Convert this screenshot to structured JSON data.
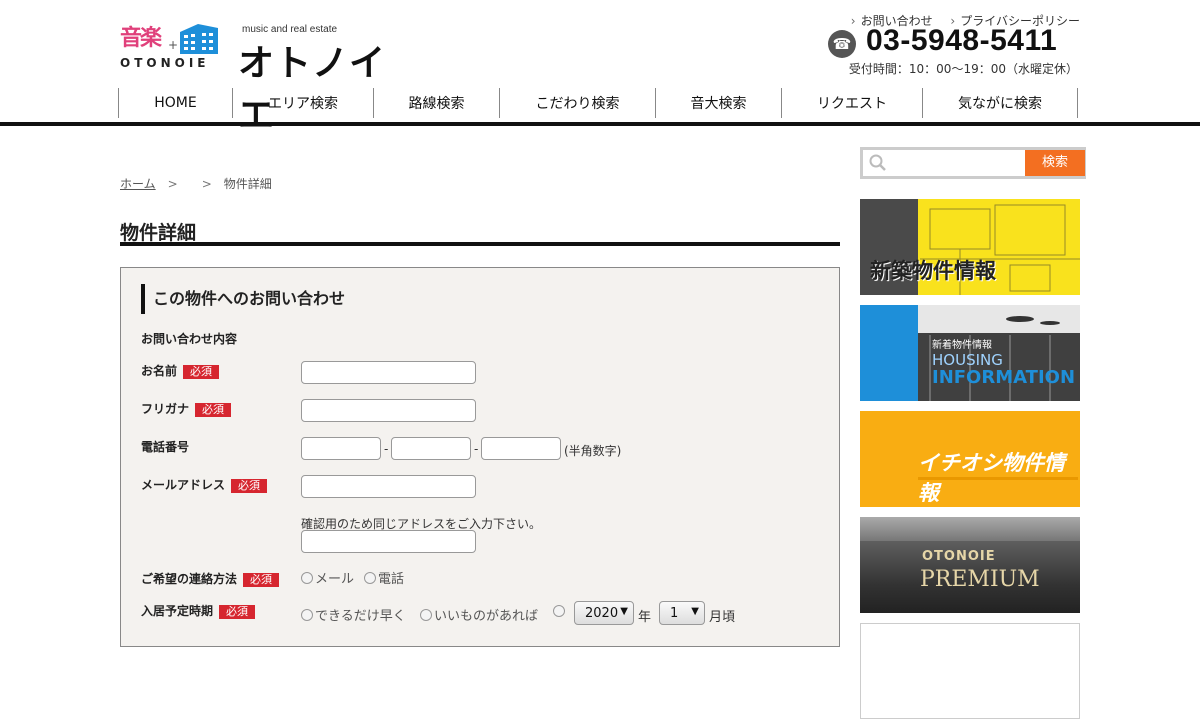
{
  "header": {
    "logo_kanji": "音楽",
    "logo_roman": "OTONOIE",
    "logo_tagline": "music and real estate",
    "logo_name": "オトノイエ",
    "top_links": [
      "お問い合わせ",
      "プライバシーポリシー"
    ],
    "phone": "03-5948-5411",
    "hours": "受付時間：10：00～19：00（水曜定休）"
  },
  "nav": [
    {
      "label": "HOME"
    },
    {
      "label": "エリア検索"
    },
    {
      "label": "路線検索"
    },
    {
      "label": "こだわり検索"
    },
    {
      "label": "音大検索"
    },
    {
      "label": "リクエスト"
    },
    {
      "label": "気ながに検索"
    }
  ],
  "breadcrumb": {
    "home": "ホーム",
    "sep1": ">",
    "sep2": ">",
    "current": "物件詳細"
  },
  "page_title": "物件詳細",
  "form": {
    "heading": "この物件へのお問い合わせ",
    "subheading": "お問い合わせ内容",
    "required_badge": "必須",
    "fields": {
      "name": "お名前",
      "furigana": "フリガナ",
      "phone": "電話番号",
      "phone_note": "(半角数字)",
      "phone_dash": "-",
      "email": "メールアドレス",
      "email_confirm_note": "確認用のため同じアドレスをご入力下さい。",
      "contact_method": "ご希望の連絡方法",
      "contact_options": [
        "メール",
        "電話"
      ],
      "move_in": "入居予定時期",
      "move_in_options": [
        "できるだけ早く",
        "いいものがあれば"
      ],
      "year_value": "2020",
      "year_unit": "年",
      "month_value": "1",
      "month_unit": "月頃"
    }
  },
  "sidebar": {
    "search_button": "検索",
    "banners": [
      {
        "title": "新築物件情報"
      },
      {
        "kicker": "新着物件情報",
        "line1": "HOUSING",
        "line2": "INFORMATION"
      },
      {
        "title": "イチオシ物件情報"
      },
      {
        "line1": "OTONOIE",
        "line2": "PREMIUM"
      }
    ]
  },
  "colors": {
    "accent": "#f36f21",
    "required": "#d6262f",
    "brand_pink": "#e0407b",
    "brand_blue": "#1e8fd9"
  }
}
